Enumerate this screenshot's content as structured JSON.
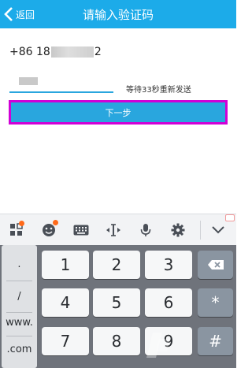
{
  "header": {
    "back_label": "返回",
    "title": "请输入验证码"
  },
  "phone": {
    "prefix": "+86 18",
    "suffix": "2"
  },
  "code": {
    "countdown_text": "等待33秒重新发送"
  },
  "next_button": {
    "label": "下一步"
  },
  "toolbar": {
    "items": [
      {
        "icon": "grid-apps-icon"
      },
      {
        "icon": "emoji-icon"
      },
      {
        "icon": "keyboard-icon"
      },
      {
        "icon": "cursor-move-icon"
      },
      {
        "icon": "microphone-icon"
      },
      {
        "icon": "gear-icon"
      },
      {
        "icon": "chevron-down-icon"
      }
    ]
  },
  "keyboard": {
    "symbols": [
      ".",
      "/",
      "www.",
      ".com"
    ],
    "rows": [
      [
        "1",
        "2",
        "3"
      ],
      [
        "4",
        "5",
        "6"
      ],
      [
        "7",
        "8",
        "9"
      ]
    ],
    "side_keys": {
      "star": "*",
      "hash": "#"
    }
  },
  "colors": {
    "header": "#1cabe9",
    "button": "#29a6de",
    "highlight_border": "#d100d6",
    "keyboard_bg": "#6f737b"
  }
}
